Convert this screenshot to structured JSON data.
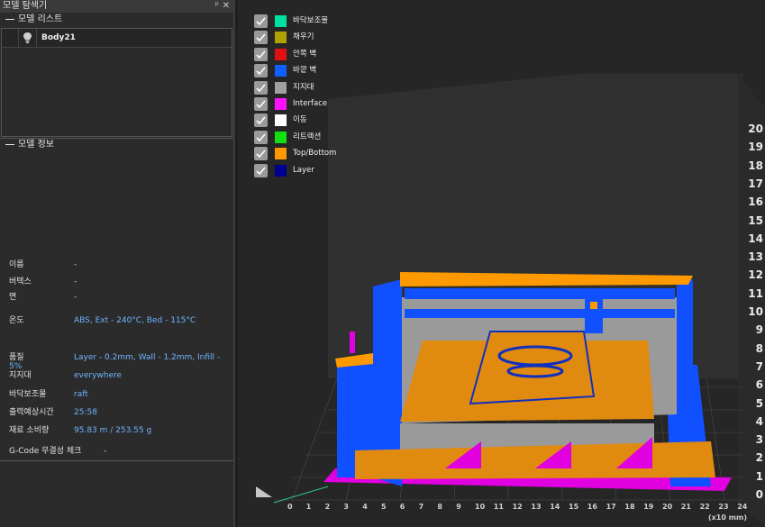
{
  "panel": {
    "title": "모델 탐색기",
    "pin_glyph": "ᵖ",
    "close_glyph": "✕",
    "model_list": {
      "header": "모델 리스트",
      "items": [
        {
          "name": "Body21"
        }
      ]
    },
    "model_info": {
      "header": "모델 정보",
      "rows": [
        {
          "label": "이름",
          "value": "-"
        },
        {
          "label": "버텍스",
          "value": "-"
        },
        {
          "label": "면",
          "value": "-"
        },
        {
          "label": "온도",
          "value": "ABS, Ext - 240°C, Bed - 115°C"
        },
        {
          "label": "품질",
          "value": "Layer - 0.2mm, Wall - 1.2mm, Infill - 5%"
        },
        {
          "label": "지지대",
          "value": "everywhere"
        },
        {
          "label": "바닥보조물",
          "value": "raft"
        },
        {
          "label": "출력예상시간",
          "value": "25:58"
        },
        {
          "label": "재료 소비량",
          "value": "95.83 m / 253.55 g"
        },
        {
          "label": "G-Code 무결성 체크",
          "value": "-"
        }
      ]
    }
  },
  "viewport": {
    "legend": [
      {
        "label": "바닥보조물",
        "color": "#00e0a0",
        "checked": true
      },
      {
        "label": "채우기",
        "color": "#b0a000",
        "checked": true
      },
      {
        "label": "안쪽 벽",
        "color": "#e01010",
        "checked": true
      },
      {
        "label": "바깥 벽",
        "color": "#1060ff",
        "checked": true
      },
      {
        "label": "지지대",
        "color": "#a0a0a0",
        "checked": true
      },
      {
        "label": "Interface",
        "color": "#ff10ff",
        "checked": true
      },
      {
        "label": "이동",
        "color": "#ffffff",
        "checked": true
      },
      {
        "label": "리트랙션",
        "color": "#10e010",
        "checked": true
      },
      {
        "label": "Top/Bottom",
        "color": "#ff9900",
        "checked": true
      },
      {
        "label": "Layer",
        "color": "#000090",
        "checked": true
      }
    ],
    "y_axis_labels": [
      "20",
      "19",
      "18",
      "17",
      "16",
      "15",
      "14",
      "13",
      "12",
      "11",
      "10",
      "9",
      "8",
      "7",
      "6",
      "5",
      "4",
      "3",
      "2",
      "1",
      "0"
    ],
    "x_axis_labels": [
      "0",
      "1",
      "2",
      "3",
      "4",
      "5",
      "6",
      "7",
      "8",
      "9",
      "10",
      "11",
      "12",
      "13",
      "14",
      "15",
      "16",
      "17",
      "18",
      "19",
      "20",
      "21",
      "22",
      "23",
      "24"
    ],
    "x_unit": "(x10 mm)"
  }
}
